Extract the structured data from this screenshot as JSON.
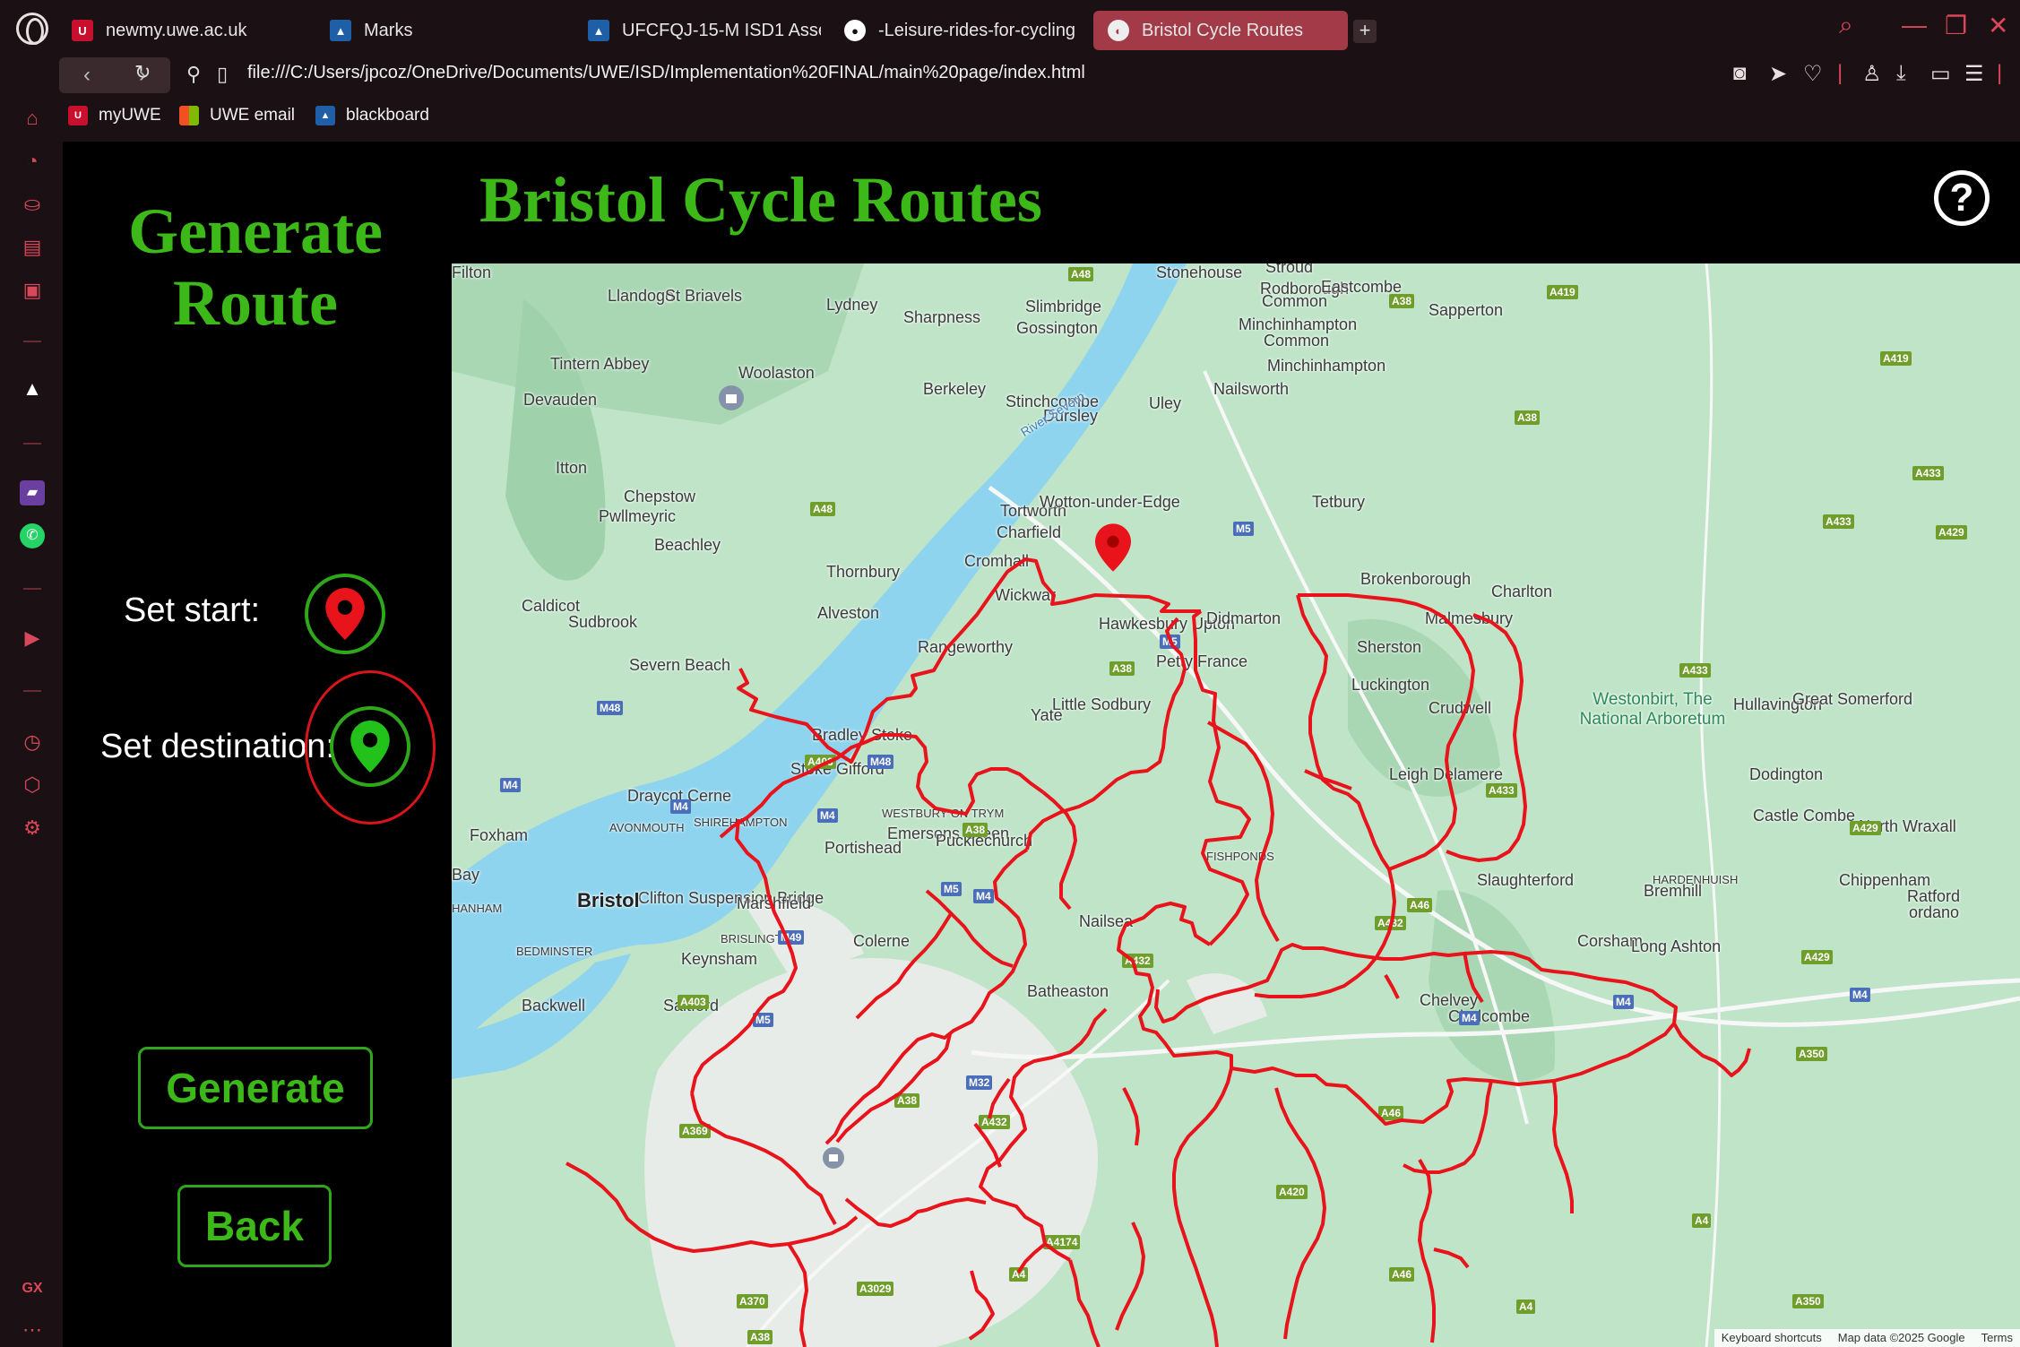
{
  "browser": {
    "tabs": [
      {
        "label": "newmy.uwe.ac.uk",
        "icon": "uwe-icon",
        "active": false
      },
      {
        "label": "Marks",
        "icon": "blackboard-icon",
        "active": false
      },
      {
        "label": "UFCFQJ-15-M ISD1 Asses",
        "icon": "blackboard-icon",
        "active": false
      },
      {
        "label": "-Leisure-rides-for-cycling",
        "icon": "github-icon",
        "active": false
      },
      {
        "label": "Bristol Cycle Routes",
        "icon": "globe-icon",
        "active": true
      }
    ],
    "url": "file:///C:/Users/jpcoz/OneDrive/Documents/UWE/ISD/Implementation%20FINAL/main%20page/index.html",
    "bookmarks": [
      {
        "label": "myUWE",
        "icon": "uwe-icon"
      },
      {
        "label": "UWE email",
        "icon": "microsoft-icon"
      },
      {
        "label": "blackboard",
        "icon": "blackboard-icon"
      }
    ],
    "sidebar_bottom_label": "GX",
    "accent_color": "#d9485a",
    "active_tab_color": "#a23a48"
  },
  "page": {
    "generate_title": "Generate Route",
    "main_title": "Bristol Cycle Routes",
    "help_symbol": "?",
    "set_start_label": "Set start:",
    "set_destination_label": "Set destination:",
    "generate_button": "Generate",
    "back_button": "Back",
    "title_color": "#3cb918",
    "start_pin_color": "#e8131b",
    "destination_pin_color": "#22c21a",
    "route_color": "#e8131b"
  },
  "map": {
    "places": [
      "Llandogo",
      "St Briavels",
      "Lydney",
      "Sharpness",
      "Slimbridge",
      "Gossington",
      "Stonehouse",
      "Stroud",
      "Rodborough",
      "Common",
      "Eastcombe",
      "Sapperton",
      "Minchinhampton",
      "Common",
      "Minchinhampton",
      "Nailsworth",
      "Tintern Abbey",
      "Woolaston",
      "Devauden",
      "Berkeley",
      "Stinchcombe",
      "Uley",
      "Dursley",
      "Itton",
      "Chepstow",
      "Pwllmeyric",
      "Beachley",
      "Tortworth",
      "Charfield",
      "Wotton-under-Edge",
      "Tetbury",
      "Crudwell",
      "Thornbury",
      "Cromhall",
      "Wickwar",
      "Caldicot",
      "Sudbrook",
      "Alveston",
      "Rangeworthy",
      "Hawkesbury Upton",
      "Didmarton",
      "Brokenborough",
      "Charlton",
      "Malmesbury",
      "Severn Beach",
      "Petty France",
      "Sherston",
      "Luckington",
      "Little Sodbury",
      "Yate",
      "Bradley Stoke",
      "Hullavington",
      "Great Somerford",
      "Stoke Gifford",
      "Dodington",
      "Leigh Delamere",
      "Filton",
      "Draycot Cerne",
      "AVONMOUTH",
      "SHIREHAMPTON",
      "WESTBURY ON TRYM",
      "Emersons Green",
      "Pucklechurch",
      "Castle Combe",
      "Foxham",
      "Portishead",
      "FISHPONDS",
      "North Wraxall",
      "HARDENHUISH",
      "Chippenham",
      "Bay",
      "Clifton Suspension Bridge",
      "Bristol",
      "Marshfield",
      "Slaughterford",
      "Bremhill",
      "Ratford",
      "ordano",
      "HANHAM",
      "Nailsea",
      "BEDMINSTER",
      "BRISLINGTON",
      "Colerne",
      "Corsham",
      "Long Ashton",
      "Keynsham",
      "Batheaston",
      "Chelvey",
      "Backwell",
      "Saltford",
      "Chalcombe"
    ],
    "river_label": "River Severn",
    "arboretum": "Westonbirt, The National Arboretum",
    "footer": [
      "Keyboard shortcuts",
      "Map data ©2025 Google",
      "Terms"
    ],
    "water_color": "#8ed4ee",
    "land_color": "#bfe4c8",
    "urban_color": "#e8ece8"
  }
}
